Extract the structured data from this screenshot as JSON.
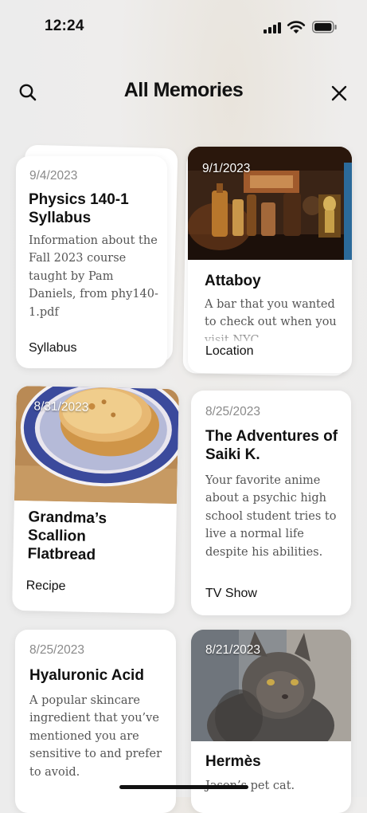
{
  "status_bar": {
    "time": "12:24"
  },
  "header": {
    "title": "All Memories"
  },
  "cards": [
    {
      "date": "9/4/2023",
      "title": "Physics 140-1 Syllabus",
      "description": "Information about the Fall 2023 course taught by Pam Daniels, from phy140-1.pdf",
      "tag": "Syllabus"
    },
    {
      "date": "9/1/2023",
      "title": "Attaboy",
      "description": "A bar that you wanted to check out when you visit NYC",
      "tag": "Location"
    },
    {
      "date": "8/31/2023",
      "title": "Grandma’s Scallion Flatbread",
      "description": "",
      "tag": "Recipe"
    },
    {
      "date": "8/25/2023",
      "title": "The Adventures of Saiki K.",
      "description": "Your favorite anime about a psychic high school student tries to live a normal life despite his abilities.",
      "tag": "TV Show"
    },
    {
      "date": "8/25/2023",
      "title": "Hyaluronic Acid",
      "description": "A popular skincare ingredient that you’ve mentioned you are sensitive to and prefer to avoid.",
      "tag": ""
    },
    {
      "date": "8/21/2023",
      "title": "Hermès",
      "description": "Jason’s pet cat.",
      "tag": ""
    }
  ]
}
